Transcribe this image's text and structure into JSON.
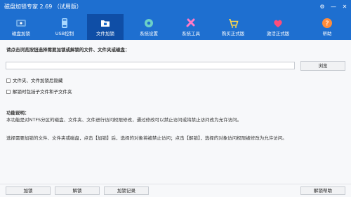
{
  "window": {
    "title": "磁盘加锁专家 2.69 （试用版）",
    "controls": [
      "⚙",
      "—",
      "✕"
    ]
  },
  "toolbar": {
    "items": [
      {
        "label": "磁盘加锁",
        "icon": "disk-lock-icon",
        "color": "#6aa7e6"
      },
      {
        "label": "USB控制",
        "icon": "usb-icon",
        "color": "#a8d8ff"
      },
      {
        "label": "文件加锁",
        "icon": "file-lock-icon",
        "color": "#ffffff",
        "active": true
      },
      {
        "label": "系统设置",
        "icon": "settings-icon",
        "color": "#6bd0c7"
      },
      {
        "label": "系统工具",
        "icon": "tools-icon",
        "color": "#ff7ac7"
      },
      {
        "label": "购买正式版",
        "icon": "cart-icon",
        "color": "#ffd84a"
      },
      {
        "label": "激活正式版",
        "icon": "activate-icon",
        "color": "#ff4d7a"
      },
      {
        "label": "帮助",
        "icon": "help-icon",
        "color": "#ff8c3a"
      }
    ]
  },
  "main": {
    "prompt": "请点击浏览按钮选择需要加锁或解锁的文件、文件夹或磁盘：",
    "path_input": {
      "value": "",
      "placeholder": ""
    },
    "browse_label": "浏览",
    "checkboxes": [
      {
        "label": "文件夹、文件加锁后隐藏",
        "checked": false
      },
      {
        "label": "解锁时包括子文件和子文件夹",
        "checked": false
      }
    ],
    "section_title": "功能说明：",
    "desc1": "本功能是对NTFS分区的磁盘、文件夹、文件进行访问权限修改，通过修改可以禁止访问或将禁止访问改为允许访问。",
    "desc2": "选择需要加锁的文件、文件夹或磁盘，点击【加锁】后，选择的对象将被禁止访问；点击【解锁】，选择的对象访问权限被修改为允许访问。"
  },
  "bottom": {
    "lock_label": "加锁",
    "unlock_label": "解锁",
    "log_label": "加锁记录",
    "help_label": "解锁帮助"
  }
}
